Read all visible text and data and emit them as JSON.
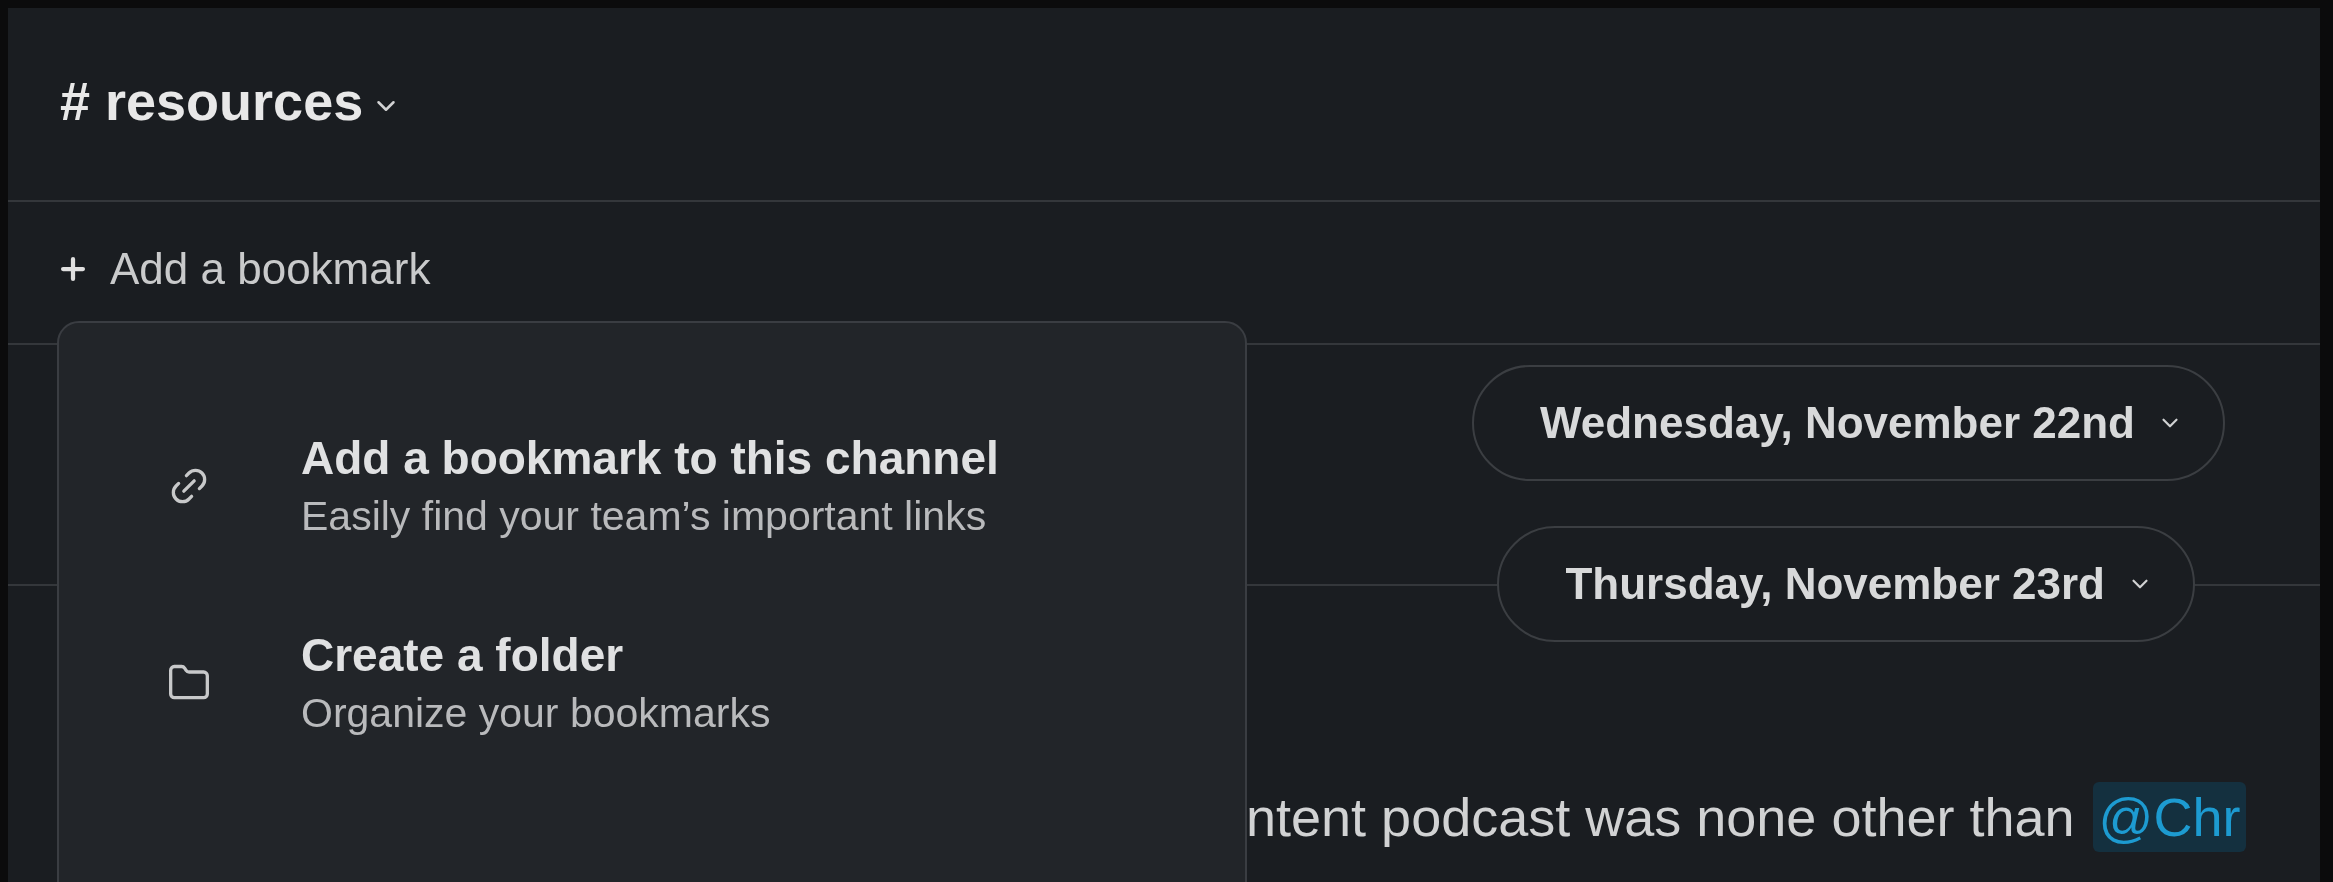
{
  "channel_header": {
    "title": "# resources"
  },
  "bookmark_bar": {
    "label": "Add a bookmark"
  },
  "bookmark_menu": {
    "items": [
      {
        "kind": "link",
        "title": "Add a bookmark to this channel",
        "subtitle": "Easily find your team’s important links"
      },
      {
        "kind": "folder",
        "title": "Create a folder",
        "subtitle": "Organize your bookmarks"
      }
    ]
  },
  "date_dividers": [
    {
      "label": "Wednesday, November 22nd",
      "lined": false
    },
    {
      "label": "Thursday, November 23rd",
      "lined": true
    }
  ],
  "message": {
    "text": "ntent podcast was none other than",
    "mention": "@Chr"
  }
}
